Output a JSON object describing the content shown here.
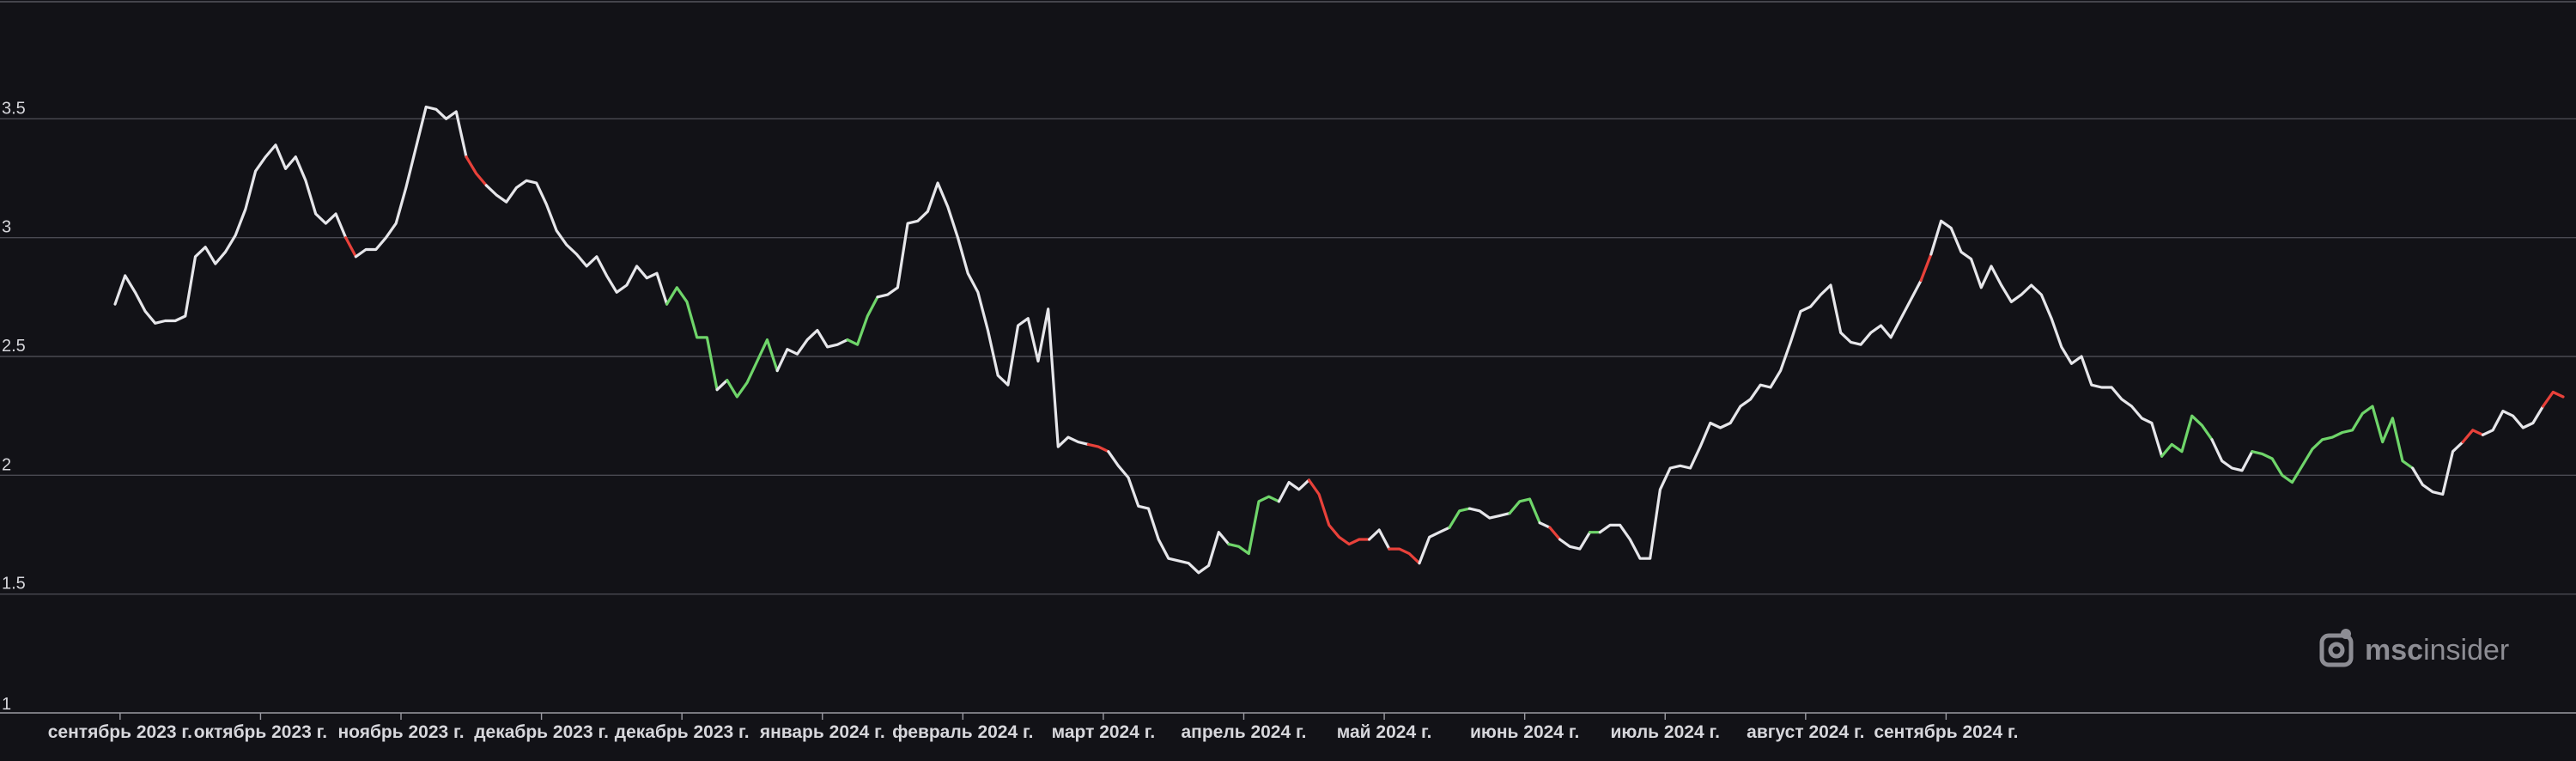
{
  "colors": {
    "background": "#121217",
    "line_neutral": "#e6e6ea",
    "line_up": "#6fd56a",
    "line_down": "#e8413a",
    "grid": "#4a4a52",
    "text": "#d7d7dc",
    "brand": "#8d8d94"
  },
  "brand": {
    "name_prefix": "msc",
    "name_suffix": "insider",
    "icon": "msc-logo-icon"
  },
  "chart_data": {
    "type": "line",
    "ylim": [
      1,
      4
    ],
    "y_ticks": [
      "1",
      "1.5",
      "2",
      "2.5",
      "3",
      "3.5"
    ],
    "grid": true,
    "legend": "none",
    "x_ticks": [
      "сентябрь 2023 г.",
      "октябрь 2023 г.",
      "ноябрь 2023 г.",
      "декабрь 2023 г.",
      "декабрь 2023 г.",
      "январь 2024 г.",
      "февраль 2024 г.",
      "март 2024 г.",
      "апрель 2024 г.",
      "май 2024 г.",
      "июнь 2024 г.",
      "июль 2024 г.",
      "август 2024 г.",
      "сентябрь 2024 г."
    ],
    "x_tick_positions": [
      0.5,
      14.5,
      28.5,
      42.5,
      56.5,
      70.5,
      84.5,
      98.5,
      112.5,
      126.5,
      140.5,
      154.5,
      168.5,
      182.5
    ],
    "series": [
      {
        "values": [
          2.72,
          2.84,
          2.77,
          2.69,
          2.64,
          2.65,
          2.65,
          2.67,
          2.92,
          2.96,
          2.89,
          2.94,
          3.01,
          3.12,
          3.28,
          3.34,
          3.39,
          3.29,
          3.34,
          3.24,
          3.1,
          3.06,
          3.1,
          3.0,
          2.92,
          2.95,
          2.95,
          3.0,
          3.06,
          3.21,
          3.38,
          3.55,
          3.54,
          3.5,
          3.53,
          3.34,
          3.27,
          3.22,
          3.18,
          3.15,
          3.21,
          3.24,
          3.23,
          3.14,
          3.03,
          2.97,
          2.93,
          2.88,
          2.92,
          2.84,
          2.77,
          2.8,
          2.88,
          2.83,
          2.85,
          2.72,
          2.79,
          2.73,
          2.58,
          2.58,
          2.36,
          2.4,
          2.33,
          2.39,
          2.48,
          2.57,
          2.44,
          2.53,
          2.51,
          2.57,
          2.61,
          2.54,
          2.55,
          2.57,
          2.55,
          2.67,
          2.75,
          2.76,
          2.79,
          3.06,
          3.07,
          3.11,
          3.23,
          3.13,
          3.0,
          2.85,
          2.77,
          2.61,
          2.42,
          2.38,
          2.63,
          2.66,
          2.48,
          2.7,
          2.12,
          2.16,
          2.14,
          2.13,
          2.12,
          2.1,
          2.04,
          1.99,
          1.87,
          1.86,
          1.73,
          1.65,
          1.64,
          1.63,
          1.59,
          1.62,
          1.76,
          1.71,
          1.7,
          1.67,
          1.89,
          1.91,
          1.89,
          1.97,
          1.94,
          1.98,
          1.92,
          1.79,
          1.74,
          1.71,
          1.73,
          1.73,
          1.77,
          1.69,
          1.69,
          1.67,
          1.63,
          1.74,
          1.76,
          1.78,
          1.85,
          1.86,
          1.85,
          1.82,
          1.83,
          1.84,
          1.89,
          1.9,
          1.8,
          1.78,
          1.73,
          1.7,
          1.69,
          1.76,
          1.76,
          1.79,
          1.79,
          1.73,
          1.65,
          1.65,
          1.94,
          2.03,
          2.04,
          2.03,
          2.12,
          2.22,
          2.2,
          2.22,
          2.29,
          2.32,
          2.38,
          2.37,
          2.44,
          2.56,
          2.69,
          2.71,
          2.76,
          2.8,
          2.6,
          2.56,
          2.55,
          2.6,
          2.63,
          2.58,
          2.66,
          2.74,
          2.82,
          2.93,
          3.07,
          3.04,
          2.94,
          2.91,
          2.79,
          2.88,
          2.8,
          2.73,
          2.76,
          2.8,
          2.76,
          2.66,
          2.54,
          2.47,
          2.5,
          2.38,
          2.37,
          2.37,
          2.32,
          2.29,
          2.24,
          2.22,
          2.08,
          2.13,
          2.1,
          2.25,
          2.21,
          2.15,
          2.06,
          2.03,
          2.02,
          2.1,
          2.09,
          2.07,
          2.0,
          1.97,
          2.04,
          2.11,
          2.15,
          2.16,
          2.18,
          2.19,
          2.26,
          2.29,
          2.14,
          2.24,
          2.06,
          2.03,
          1.96,
          1.93,
          1.92,
          2.1,
          2.14,
          2.19,
          2.17,
          2.19,
          2.27,
          2.25,
          2.2,
          2.22,
          2.29,
          2.35,
          2.33
        ],
        "trend_up_segments": [
          [
            55,
            60
          ],
          [
            61,
            66
          ],
          [
            73,
            76
          ],
          [
            111,
            116
          ],
          [
            133,
            135
          ],
          [
            139,
            142
          ],
          [
            147,
            148
          ],
          [
            204,
            209
          ],
          [
            213,
            220
          ],
          [
            220,
            229
          ]
        ],
        "trend_down_segments": [
          [
            23,
            24
          ],
          [
            35,
            37
          ],
          [
            97,
            99
          ],
          [
            119,
            125
          ],
          [
            127,
            130
          ],
          [
            143,
            144
          ],
          [
            180,
            181
          ],
          [
            234,
            236
          ],
          [
            242,
            245
          ],
          [
            247,
            248
          ],
          [
            251,
            253
          ]
        ]
      }
    ]
  }
}
